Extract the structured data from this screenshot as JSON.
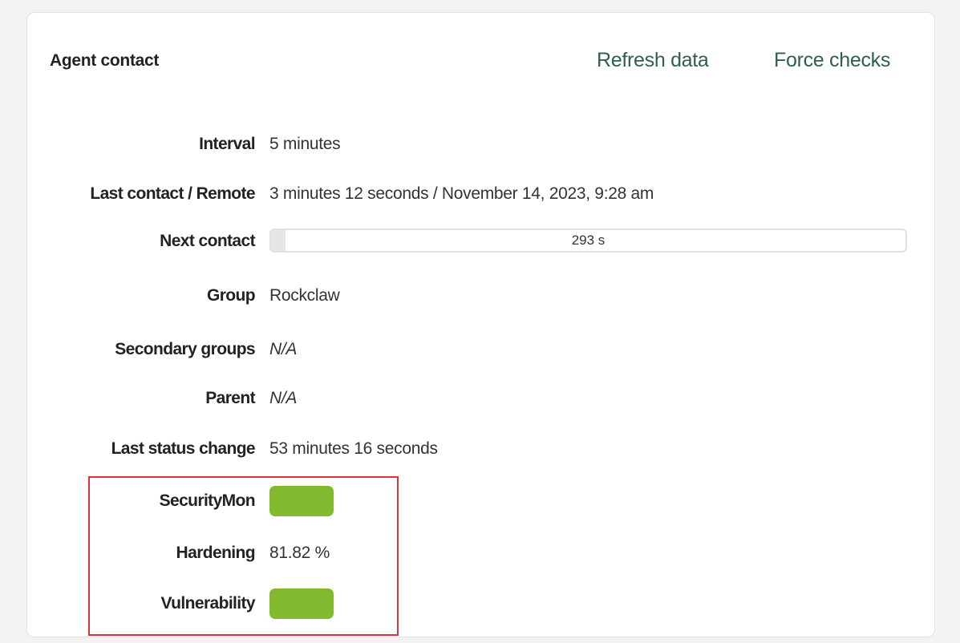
{
  "header": {
    "title": "Agent contact",
    "refresh_label": "Refresh data",
    "force_label": "Force checks"
  },
  "details": {
    "interval": {
      "label": "Interval",
      "value": "5 minutes"
    },
    "last_contact": {
      "label": "Last contact / Remote",
      "value": "3 minutes 12 seconds / November 14, 2023, 9:28 am"
    },
    "next_contact": {
      "label": "Next contact",
      "value": "293 s",
      "progress_percent": 2.3
    },
    "group": {
      "label": "Group",
      "value": "Rockclaw"
    },
    "secondary_groups": {
      "label": "Secondary groups",
      "value": "N/A"
    },
    "parent": {
      "label": "Parent",
      "value": "N/A"
    },
    "last_status_change": {
      "label": "Last status change",
      "value": "53 minutes 16 seconds"
    },
    "security_mon": {
      "label": "SecurityMon",
      "status_color": "#82b92e"
    },
    "hardening": {
      "label": "Hardening",
      "value": "81.82 %"
    },
    "vulnerability": {
      "label": "Vulnerability",
      "status_color": "#82b92e"
    }
  },
  "colors": {
    "accent": "#2f5f52",
    "status_ok": "#82b92e",
    "highlight": "#e0303a"
  }
}
